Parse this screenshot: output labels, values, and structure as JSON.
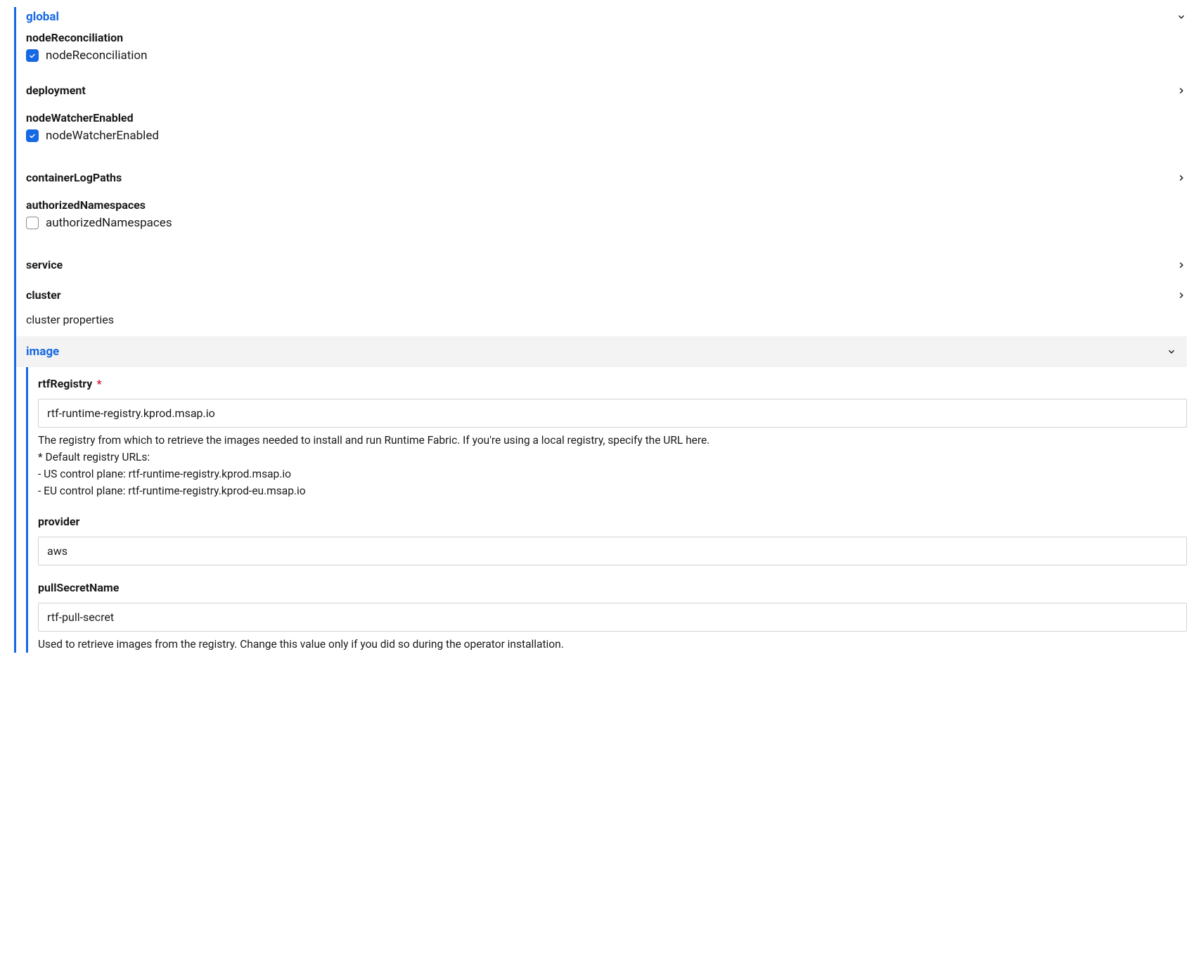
{
  "global": {
    "title": "global",
    "nodeReconciliation": {
      "label": "nodeReconciliation",
      "checkbox_label": "nodeReconciliation",
      "checked": true
    },
    "deployment": {
      "label": "deployment"
    },
    "nodeWatcherEnabled": {
      "label": "nodeWatcherEnabled",
      "checkbox_label": "nodeWatcherEnabled",
      "checked": true
    },
    "containerLogPaths": {
      "label": "containerLogPaths"
    },
    "authorizedNamespaces": {
      "label": "authorizedNamespaces",
      "checkbox_label": "authorizedNamespaces",
      "checked": false
    },
    "service": {
      "label": "service"
    },
    "cluster": {
      "label": "cluster",
      "description": "cluster properties"
    },
    "image": {
      "title": "image",
      "rtfRegistry": {
        "label": "rtfRegistry",
        "value": "rtf-runtime-registry.kprod.msap.io",
        "help_line1": "The registry from which to retrieve the images needed to install and run Runtime Fabric. If you're using a local registry, specify the URL here.",
        "help_line2": "* Default registry URLs:",
        "help_line3": "- US control plane: rtf-runtime-registry.kprod.msap.io",
        "help_line4": "- EU control plane: rtf-runtime-registry.kprod-eu.msap.io"
      },
      "provider": {
        "label": "provider",
        "value": "aws"
      },
      "pullSecretName": {
        "label": "pullSecretName",
        "value": "rtf-pull-secret",
        "help": "Used to retrieve images from the registry. Change this value only if you did so during the operator installation."
      }
    }
  },
  "required_marker": "*"
}
